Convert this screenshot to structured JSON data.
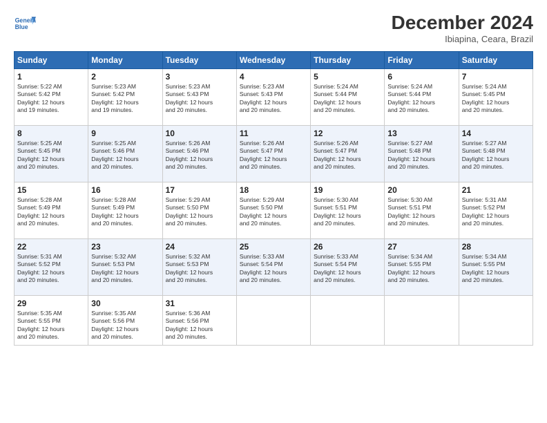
{
  "logo": {
    "line1": "General",
    "line2": "Blue"
  },
  "title": "December 2024",
  "subtitle": "Ibiapina, Ceara, Brazil",
  "weekdays": [
    "Sunday",
    "Monday",
    "Tuesday",
    "Wednesday",
    "Thursday",
    "Friday",
    "Saturday"
  ],
  "weeks": [
    [
      {
        "day": "1",
        "info": "Sunrise: 5:22 AM\nSunset: 5:42 PM\nDaylight: 12 hours\nand 19 minutes."
      },
      {
        "day": "2",
        "info": "Sunrise: 5:23 AM\nSunset: 5:42 PM\nDaylight: 12 hours\nand 19 minutes."
      },
      {
        "day": "3",
        "info": "Sunrise: 5:23 AM\nSunset: 5:43 PM\nDaylight: 12 hours\nand 20 minutes."
      },
      {
        "day": "4",
        "info": "Sunrise: 5:23 AM\nSunset: 5:43 PM\nDaylight: 12 hours\nand 20 minutes."
      },
      {
        "day": "5",
        "info": "Sunrise: 5:24 AM\nSunset: 5:44 PM\nDaylight: 12 hours\nand 20 minutes."
      },
      {
        "day": "6",
        "info": "Sunrise: 5:24 AM\nSunset: 5:44 PM\nDaylight: 12 hours\nand 20 minutes."
      },
      {
        "day": "7",
        "info": "Sunrise: 5:24 AM\nSunset: 5:45 PM\nDaylight: 12 hours\nand 20 minutes."
      }
    ],
    [
      {
        "day": "8",
        "info": "Sunrise: 5:25 AM\nSunset: 5:45 PM\nDaylight: 12 hours\nand 20 minutes."
      },
      {
        "day": "9",
        "info": "Sunrise: 5:25 AM\nSunset: 5:46 PM\nDaylight: 12 hours\nand 20 minutes."
      },
      {
        "day": "10",
        "info": "Sunrise: 5:26 AM\nSunset: 5:46 PM\nDaylight: 12 hours\nand 20 minutes."
      },
      {
        "day": "11",
        "info": "Sunrise: 5:26 AM\nSunset: 5:47 PM\nDaylight: 12 hours\nand 20 minutes."
      },
      {
        "day": "12",
        "info": "Sunrise: 5:26 AM\nSunset: 5:47 PM\nDaylight: 12 hours\nand 20 minutes."
      },
      {
        "day": "13",
        "info": "Sunrise: 5:27 AM\nSunset: 5:48 PM\nDaylight: 12 hours\nand 20 minutes."
      },
      {
        "day": "14",
        "info": "Sunrise: 5:27 AM\nSunset: 5:48 PM\nDaylight: 12 hours\nand 20 minutes."
      }
    ],
    [
      {
        "day": "15",
        "info": "Sunrise: 5:28 AM\nSunset: 5:49 PM\nDaylight: 12 hours\nand 20 minutes."
      },
      {
        "day": "16",
        "info": "Sunrise: 5:28 AM\nSunset: 5:49 PM\nDaylight: 12 hours\nand 20 minutes."
      },
      {
        "day": "17",
        "info": "Sunrise: 5:29 AM\nSunset: 5:50 PM\nDaylight: 12 hours\nand 20 minutes."
      },
      {
        "day": "18",
        "info": "Sunrise: 5:29 AM\nSunset: 5:50 PM\nDaylight: 12 hours\nand 20 minutes."
      },
      {
        "day": "19",
        "info": "Sunrise: 5:30 AM\nSunset: 5:51 PM\nDaylight: 12 hours\nand 20 minutes."
      },
      {
        "day": "20",
        "info": "Sunrise: 5:30 AM\nSunset: 5:51 PM\nDaylight: 12 hours\nand 20 minutes."
      },
      {
        "day": "21",
        "info": "Sunrise: 5:31 AM\nSunset: 5:52 PM\nDaylight: 12 hours\nand 20 minutes."
      }
    ],
    [
      {
        "day": "22",
        "info": "Sunrise: 5:31 AM\nSunset: 5:52 PM\nDaylight: 12 hours\nand 20 minutes."
      },
      {
        "day": "23",
        "info": "Sunrise: 5:32 AM\nSunset: 5:53 PM\nDaylight: 12 hours\nand 20 minutes."
      },
      {
        "day": "24",
        "info": "Sunrise: 5:32 AM\nSunset: 5:53 PM\nDaylight: 12 hours\nand 20 minutes."
      },
      {
        "day": "25",
        "info": "Sunrise: 5:33 AM\nSunset: 5:54 PM\nDaylight: 12 hours\nand 20 minutes."
      },
      {
        "day": "26",
        "info": "Sunrise: 5:33 AM\nSunset: 5:54 PM\nDaylight: 12 hours\nand 20 minutes."
      },
      {
        "day": "27",
        "info": "Sunrise: 5:34 AM\nSunset: 5:55 PM\nDaylight: 12 hours\nand 20 minutes."
      },
      {
        "day": "28",
        "info": "Sunrise: 5:34 AM\nSunset: 5:55 PM\nDaylight: 12 hours\nand 20 minutes."
      }
    ],
    [
      {
        "day": "29",
        "info": "Sunrise: 5:35 AM\nSunset: 5:55 PM\nDaylight: 12 hours\nand 20 minutes."
      },
      {
        "day": "30",
        "info": "Sunrise: 5:35 AM\nSunset: 5:56 PM\nDaylight: 12 hours\nand 20 minutes."
      },
      {
        "day": "31",
        "info": "Sunrise: 5:36 AM\nSunset: 5:56 PM\nDaylight: 12 hours\nand 20 minutes."
      },
      null,
      null,
      null,
      null
    ]
  ]
}
